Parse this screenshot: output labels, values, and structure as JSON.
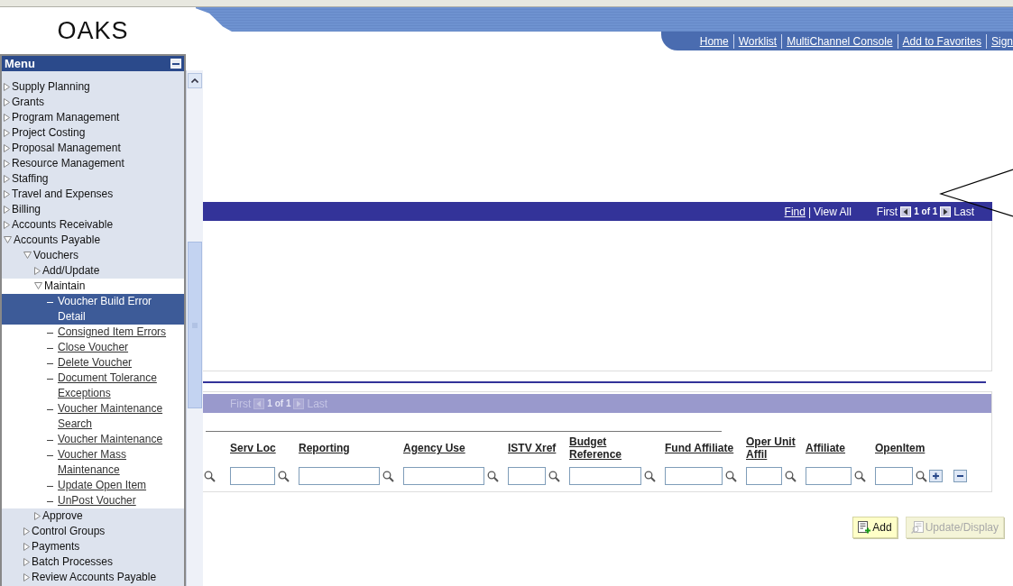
{
  "logo": "OAKS",
  "header_links": [
    {
      "label": "Home"
    },
    {
      "label": "Worklist"
    },
    {
      "label": "MultiChannel Console"
    },
    {
      "label": "Add to Favorites"
    },
    {
      "label": "Sign"
    }
  ],
  "menu": {
    "title": "Menu",
    "items": [
      {
        "label": "Supply Planning",
        "kind": "folder",
        "expanded": false
      },
      {
        "label": "Grants",
        "kind": "folder",
        "expanded": false
      },
      {
        "label": "Program Management",
        "kind": "folder",
        "expanded": false
      },
      {
        "label": "Project Costing",
        "kind": "folder",
        "expanded": false
      },
      {
        "label": "Proposal Management",
        "kind": "folder",
        "expanded": false
      },
      {
        "label": "Resource Management",
        "kind": "folder",
        "expanded": false
      },
      {
        "label": "Staffing",
        "kind": "folder",
        "expanded": false
      },
      {
        "label": "Travel and Expenses",
        "kind": "folder",
        "expanded": false
      },
      {
        "label": "Billing",
        "kind": "folder",
        "expanded": false
      },
      {
        "label": "Accounts Receivable",
        "kind": "folder",
        "expanded": false
      },
      {
        "label": "Accounts Payable",
        "kind": "folder",
        "expanded": true,
        "children": [
          {
            "label": "Vouchers",
            "kind": "folder",
            "expanded": true,
            "children": [
              {
                "label": "Add/Update",
                "kind": "folder",
                "expanded": false
              },
              {
                "label": "Maintain",
                "kind": "folder",
                "expanded": true,
                "children": [
                  {
                    "label": "Voucher Build Error Detail",
                    "kind": "page",
                    "selected": true
                  },
                  {
                    "label": "Consigned Item Errors",
                    "kind": "page",
                    "selected": false
                  },
                  {
                    "label": "Close Voucher",
                    "kind": "page",
                    "selected": false
                  },
                  {
                    "label": "Delete Voucher",
                    "kind": "page",
                    "selected": false
                  },
                  {
                    "label": "Document Tolerance Exceptions",
                    "kind": "page",
                    "selected": false
                  },
                  {
                    "label": "Voucher Maintenance Search",
                    "kind": "page",
                    "selected": false
                  },
                  {
                    "label": "Voucher Maintenance",
                    "kind": "page",
                    "selected": false
                  },
                  {
                    "label": "Voucher Mass Maintenance",
                    "kind": "page",
                    "selected": false
                  },
                  {
                    "label": "Update Open Item",
                    "kind": "page",
                    "selected": false
                  },
                  {
                    "label": "UnPost Voucher",
                    "kind": "page",
                    "selected": false
                  }
                ]
              },
              {
                "label": "Approve",
                "kind": "folder",
                "expanded": false
              }
            ]
          },
          {
            "label": "Control Groups",
            "kind": "folder",
            "expanded": false
          },
          {
            "label": "Payments",
            "kind": "folder",
            "expanded": false
          },
          {
            "label": "Batch Processes",
            "kind": "folder",
            "expanded": false
          },
          {
            "label": "Review Accounts Payable",
            "kind": "folder",
            "expanded": false
          }
        ]
      }
    ]
  },
  "find_bar": {
    "links": [
      {
        "label": "Find",
        "kind": "link"
      },
      {
        "label": "View All",
        "kind": "text"
      }
    ],
    "separator": "|",
    "pager": {
      "first": "First",
      "count": "1 of 1",
      "last": "Last",
      "disabled": false
    }
  },
  "grid": {
    "pager": {
      "first": "First",
      "count": "1 of 1",
      "last": "Last",
      "disabled": true
    },
    "columns": [
      {
        "label": "Serv Loc"
      },
      {
        "label": "Reporting"
      },
      {
        "label": "Agency Use"
      },
      {
        "label": "ISTV Xref"
      },
      {
        "label": "Budget Reference"
      },
      {
        "label": "Fund Affiliate"
      },
      {
        "label": "Oper Unit Affil"
      },
      {
        "label": "Affiliate"
      },
      {
        "label": "OpenItem"
      }
    ]
  },
  "buttons": [
    {
      "label": "Add",
      "disabled": false
    },
    {
      "label": "Update/Display",
      "disabled": true
    }
  ]
}
